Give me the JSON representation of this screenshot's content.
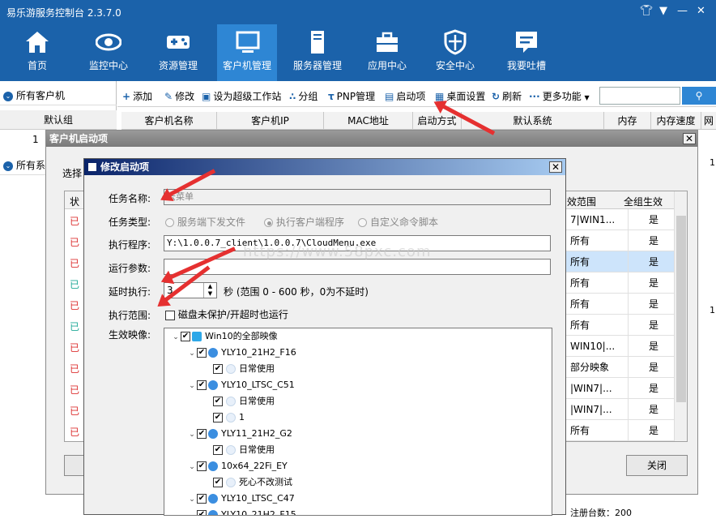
{
  "app": {
    "title": "易乐游服务控制台 2.3.7.0"
  },
  "nav": {
    "items": [
      {
        "label": "首页",
        "icon": "home-icon"
      },
      {
        "label": "监控中心",
        "icon": "eye-icon"
      },
      {
        "label": "资源管理",
        "icon": "gamepad-icon"
      },
      {
        "label": "客户机管理",
        "icon": "monitor-icon",
        "active": true
      },
      {
        "label": "服务器管理",
        "icon": "server-icon"
      },
      {
        "label": "应用中心",
        "icon": "toolbox-icon"
      },
      {
        "label": "安全中心",
        "icon": "shield-icon"
      },
      {
        "label": "我要吐槽",
        "icon": "feedback-icon"
      }
    ]
  },
  "left": {
    "all_clients": "所有客户机",
    "default_group": "默认组",
    "row_num": "1",
    "all_systems": "所有系"
  },
  "toolbar": {
    "add": "添加",
    "edit": "修改",
    "super_ws": "设为超级工作站",
    "group": "分组",
    "pnp": "PNP管理",
    "startup": "启动项",
    "desktop": "桌面设置",
    "refresh": "刷新",
    "more": "更多功能"
  },
  "client_cols": [
    "客户机名称",
    "客户机IP",
    "MAC地址",
    "启动方式",
    "默认系统",
    "内存",
    "内存速度",
    "网"
  ],
  "dlg1": {
    "title": "客户机启动项",
    "select": "选择",
    "col_status": "状",
    "col_scope": "效范围",
    "col_all": "全组生效",
    "status_items": [
      "已",
      "已",
      "已",
      "已",
      "已",
      "已",
      "已",
      "已",
      "已",
      "已",
      "已"
    ],
    "rows": [
      {
        "scope": "7|WIN1...",
        "all": "是"
      },
      {
        "scope": "所有",
        "all": "是"
      },
      {
        "scope": "所有",
        "all": "是"
      },
      {
        "scope": "所有",
        "all": "是"
      },
      {
        "scope": "所有",
        "all": "是"
      },
      {
        "scope": "所有",
        "all": "是"
      },
      {
        "scope": "WIN10|...",
        "all": "是"
      },
      {
        "scope": "部分映象",
        "all": "是"
      },
      {
        "scope": "|WIN7|...",
        "all": "是"
      },
      {
        "scope": "|WIN7|...",
        "all": "是"
      },
      {
        "scope": "所有",
        "all": "是"
      }
    ],
    "close": "关闭"
  },
  "dlg2": {
    "title": "修改启动项",
    "task_name_label": "任务名称:",
    "task_name_value": "云菜单",
    "task_type_label": "任务类型:",
    "type_opt1": "服务端下发文件",
    "type_opt2": "执行客户端程序",
    "type_opt3": "自定义命令脚本",
    "exec_label": "执行程序:",
    "exec_value": "Y:\\1.0.0.7_client\\1.0.0.7\\CloudMenu.exe",
    "args_label": "运行参数:",
    "args_value": "",
    "delay_label": "延时执行:",
    "delay_value": "3",
    "delay_hint": "秒 (范围 0 - 600 秒，0为不延时)",
    "scope_label": "执行范围:",
    "scope_check": "磁盘未保护/开超时也运行",
    "images_label": "生效映像:",
    "tree": [
      {
        "level": 0,
        "label": "Win10的全部映像"
      },
      {
        "level": 1,
        "label": "YLY10_21H2_F16"
      },
      {
        "level": 2,
        "label": "日常使用"
      },
      {
        "level": 1,
        "label": "YLY10_LTSC_C51"
      },
      {
        "level": 2,
        "label": "日常使用"
      },
      {
        "level": 2,
        "label": "1"
      },
      {
        "level": 1,
        "label": "YLY11_21H2_G2"
      },
      {
        "level": 2,
        "label": "日常使用"
      },
      {
        "level": 1,
        "label": "10x64_22Fi_EY"
      },
      {
        "level": 2,
        "label": "死心不改测试"
      },
      {
        "level": 1,
        "label": "YLY10_LTSC_C47"
      },
      {
        "level": 1,
        "label": "YLY10_21H2_F15"
      }
    ]
  },
  "watermark": "https://www.58pxc.com",
  "bottom": {
    "count": "注册台数：200"
  },
  "right_vals": [
    "1",
    "1"
  ],
  "colors": {
    "brand": "#1b62aa",
    "active": "#2e86d4",
    "arrow": "#e53030"
  }
}
